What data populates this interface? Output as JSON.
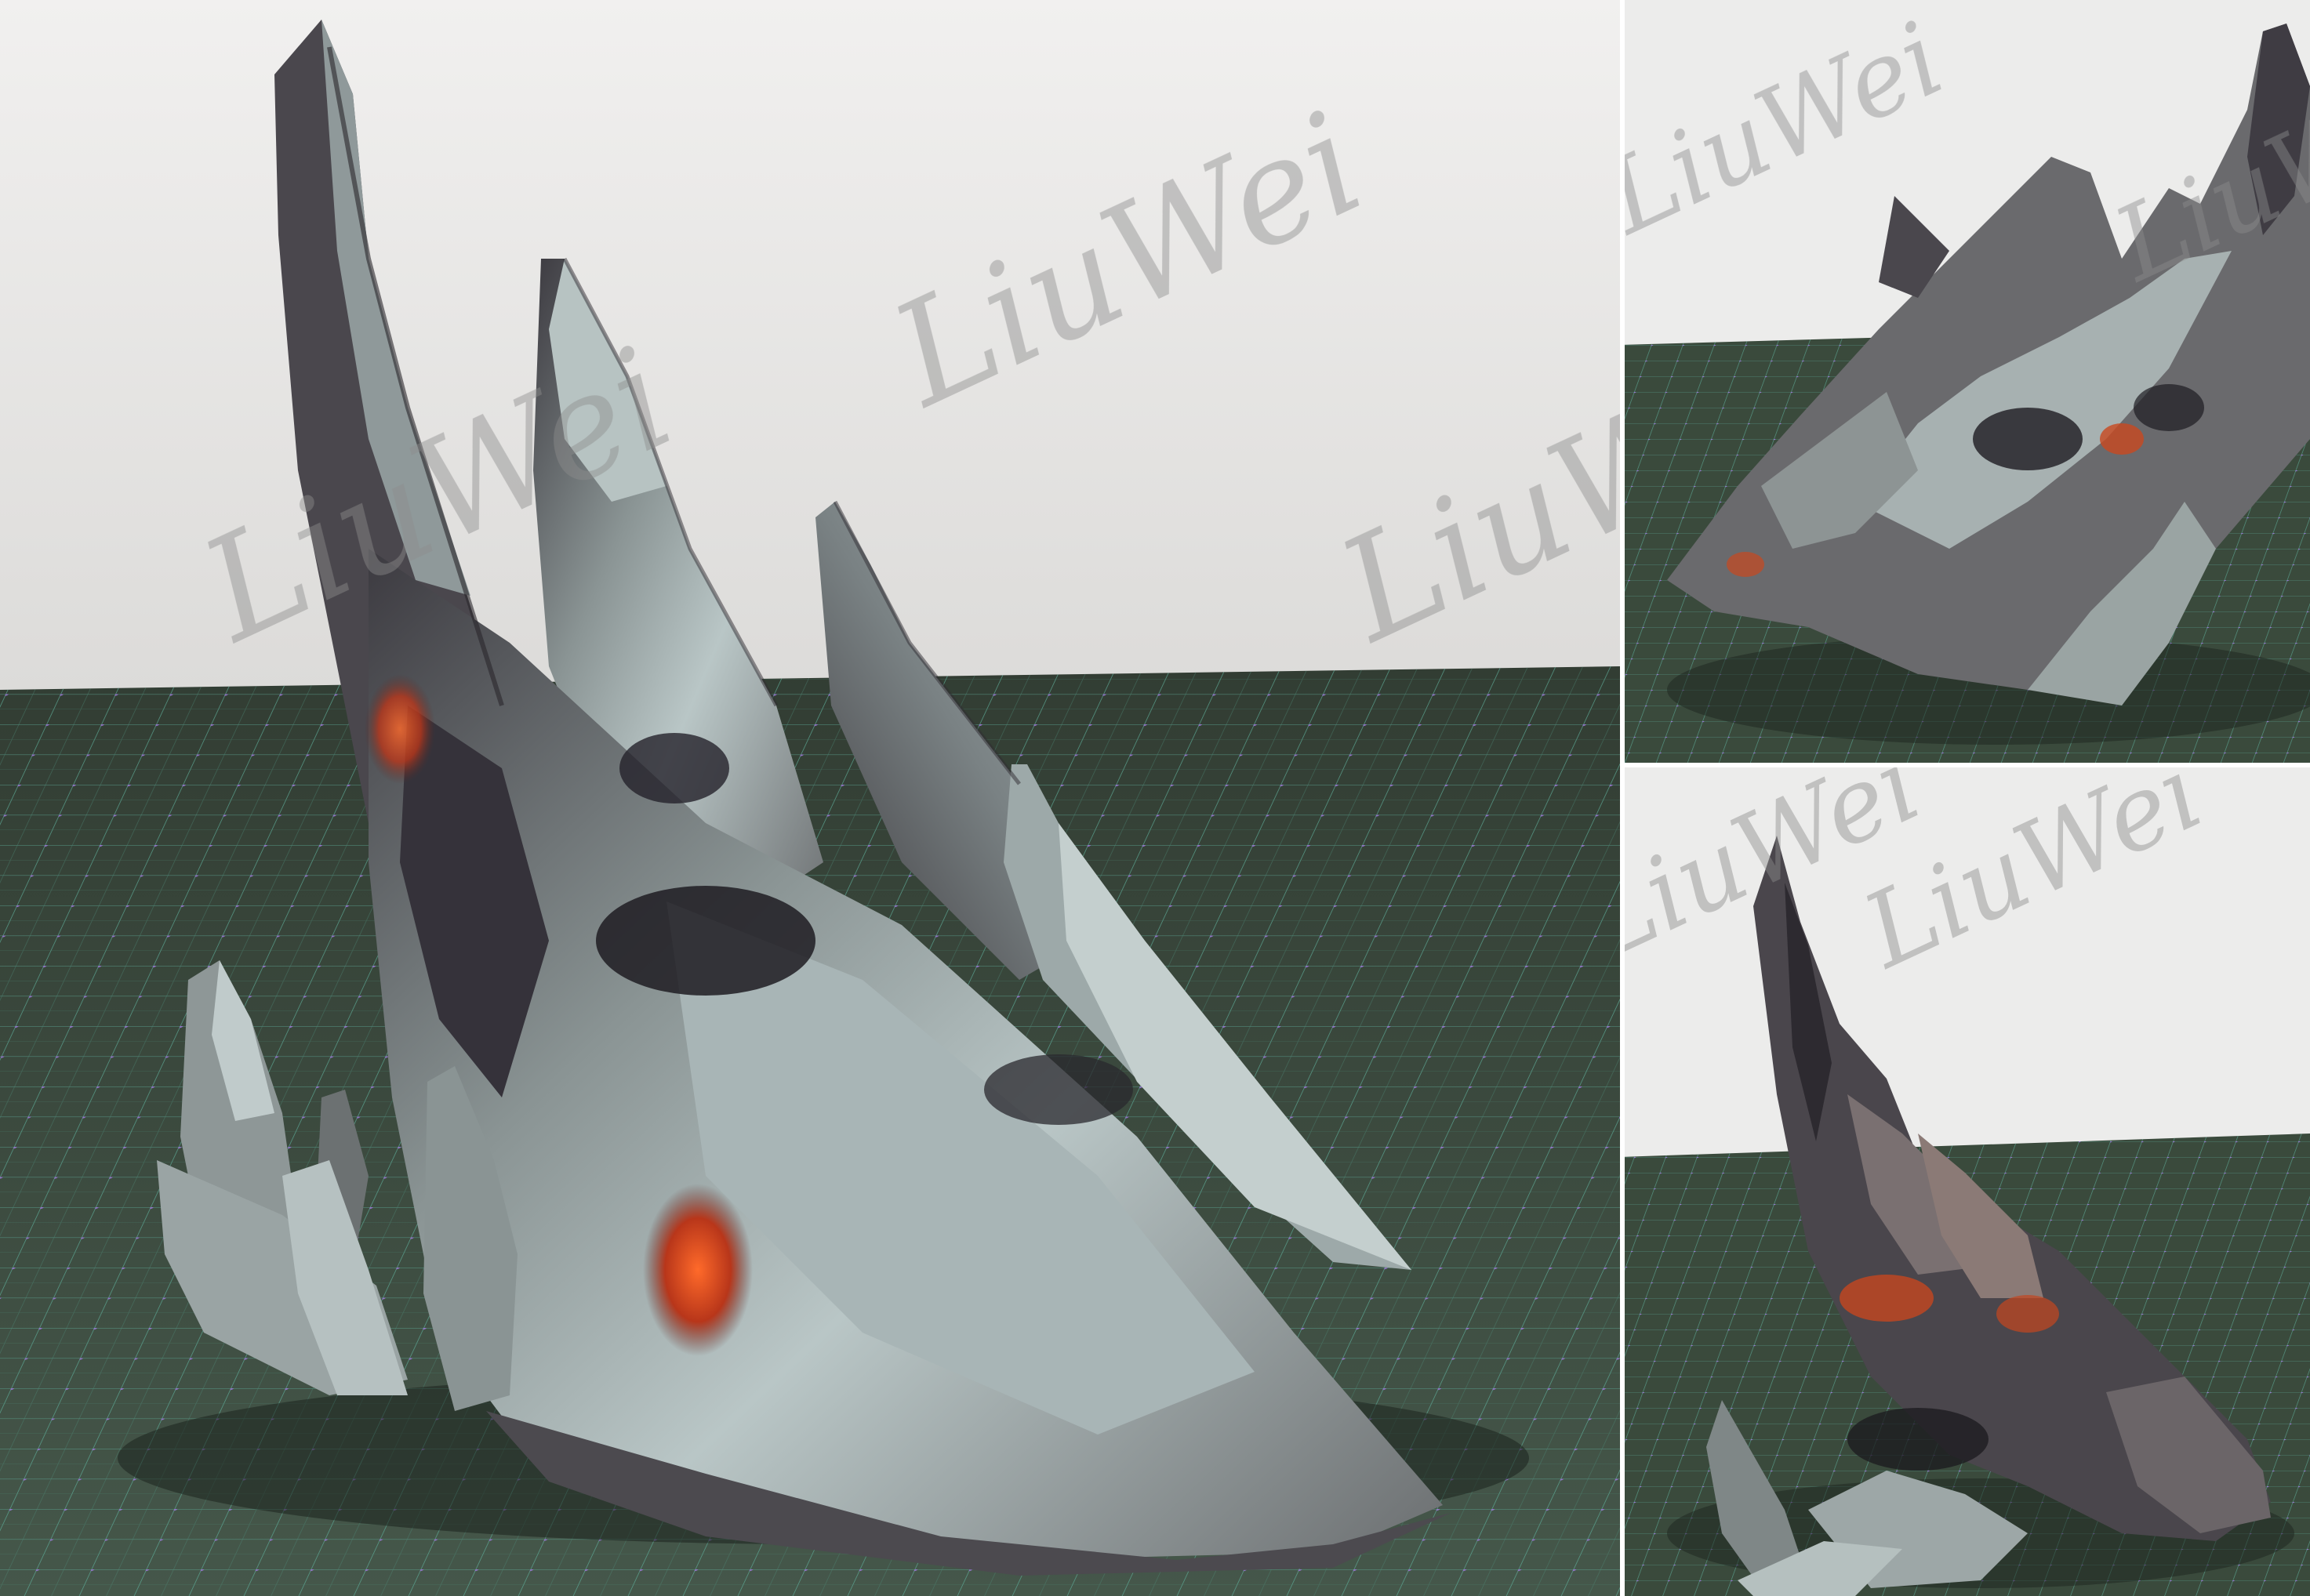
{
  "image": {
    "description": "",
    "watermark_text": "LiuWei",
    "panels": [
      {
        "name": "main-view"
      },
      {
        "name": "top-right-view"
      },
      {
        "name": "bottom-right-view"
      }
    ]
  },
  "colors": {
    "sky": "#ecebea",
    "grid_floor": "#3b4a3b",
    "grid_line": "#5fae9a",
    "grid_point": "#9a7ad6",
    "rock_light": "#b8c4c4",
    "rock_mid": "#7e8586",
    "rock_dark": "#2c2a2e",
    "lava": "#d2451f",
    "watermark": "#b3b3b3"
  }
}
